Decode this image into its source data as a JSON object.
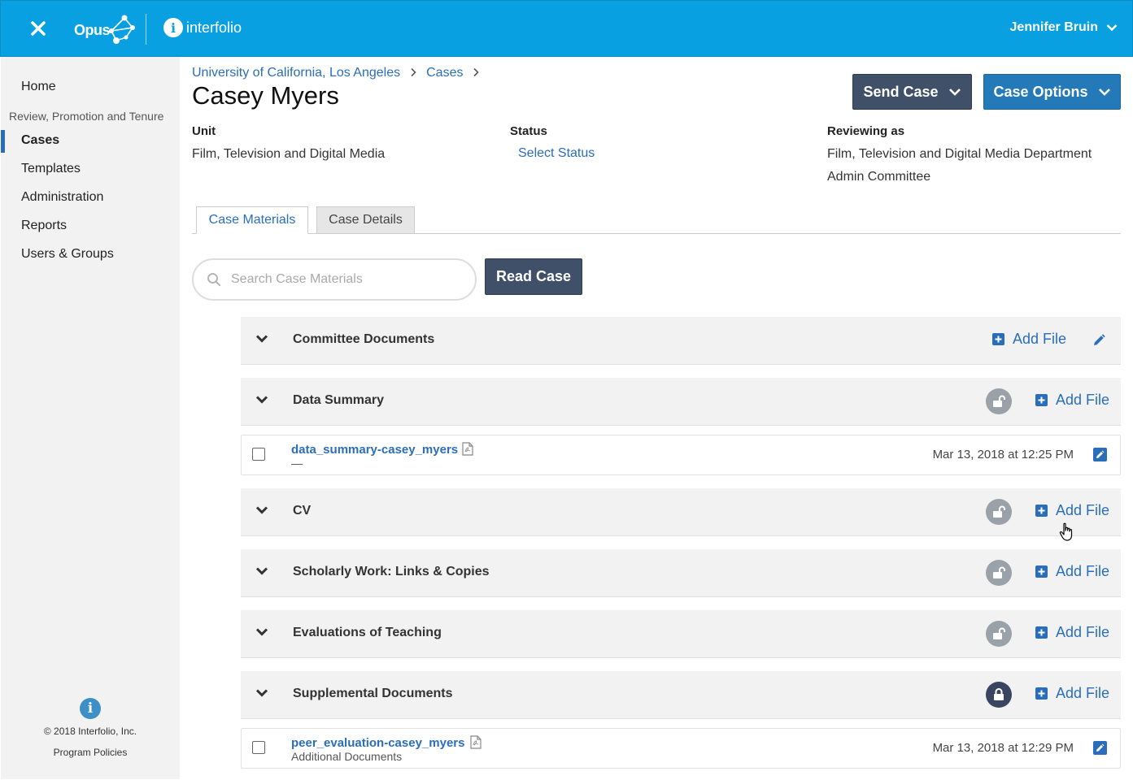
{
  "header": {
    "brand_opus": "Opus",
    "brand_interfolio": "interfolio",
    "user_name": "Jennifer Bruin",
    "colors": {
      "topbar": "#08a0e0",
      "link": "#2a6ebb",
      "dark_button": "#3f5068",
      "blue_button": "#2479b8"
    }
  },
  "sidebar": {
    "home": "Home",
    "section_heading": "Review, Promotion and Tenure",
    "items": [
      {
        "label": "Cases",
        "active": true
      },
      {
        "label": "Templates"
      },
      {
        "label": "Administration"
      },
      {
        "label": "Reports"
      },
      {
        "label": "Users & Groups"
      }
    ],
    "footer_copyright": "© 2018 Interfolio, Inc.",
    "footer_policies": "Program Policies"
  },
  "breadcrumb": {
    "institution": "University of California, Los Angeles",
    "cases": "Cases"
  },
  "page": {
    "title": "Casey Myers",
    "send_case": "Send Case",
    "case_options": "Case Options",
    "unit_label": "Unit",
    "unit_value": "Film, Television and Digital Media",
    "status_label": "Status",
    "status_link": "Select Status",
    "reviewing_label": "Reviewing as",
    "reviewing_line1": "Film, Television and Digital Media Department",
    "reviewing_line2": "Admin Committee"
  },
  "tabs": [
    {
      "label": "Case Materials",
      "active": true
    },
    {
      "label": "Case Details",
      "active": false
    }
  ],
  "search": {
    "placeholder": "Search Case Materials"
  },
  "read_case": "Read Case",
  "add_file_label": "Add File",
  "sections": [
    {
      "title": "Committee Documents",
      "lock": "none"
    },
    {
      "title": "Data Summary",
      "lock": "unlocked"
    },
    {
      "title": "CV",
      "lock": "unlocked"
    },
    {
      "title": "Scholarly Work: Links & Copies",
      "lock": "unlocked"
    },
    {
      "title": "Evaluations of Teaching",
      "lock": "unlocked"
    },
    {
      "title": "Supplemental Documents",
      "lock": "locked"
    }
  ],
  "files": [
    {
      "name": "data_summary-casey_myers",
      "subtitle": "—",
      "date": "Mar 13, 2018 at 12:25 PM"
    },
    {
      "name": "peer_evaluation-casey_myers",
      "subtitle": "Additional Documents",
      "date": "Mar 13, 2018 at 12:29 PM"
    }
  ]
}
